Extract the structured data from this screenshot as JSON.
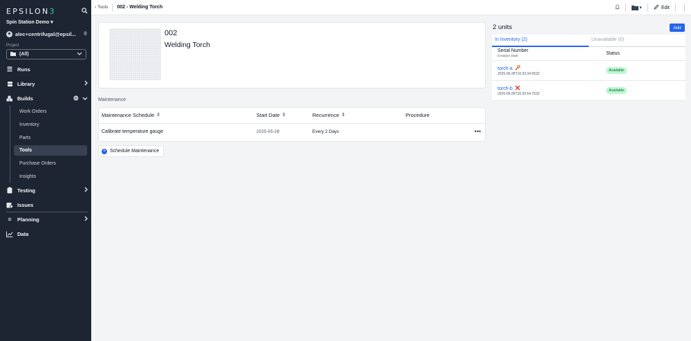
{
  "sidebar": {
    "logo_main": "EPSILON",
    "logo_accent": "3",
    "workspace": "Spin Station Demo",
    "user": "alec+centrifugal@epsil...",
    "project_label": "Project",
    "project_value": "(All)",
    "nav": {
      "runs": "Runs",
      "library": "Library",
      "builds": "Builds",
      "testing": "Testing",
      "issues": "Issues",
      "planning": "Planning",
      "data": "Data"
    },
    "builds_sub": [
      "Work Orders",
      "Inventory",
      "Parts",
      "Tools",
      "Purchase Orders",
      "Insights"
    ]
  },
  "topbar": {
    "back_label": "Tools",
    "title": "002 - Welding Torch",
    "edit_label": "Edit"
  },
  "tool": {
    "number": "002",
    "name": "Welding Torch"
  },
  "maintenance": {
    "section_label": "Maintenance",
    "columns": [
      "Maintenance Schedule",
      "Start Date",
      "Recurrence",
      "Procedure"
    ],
    "rows": [
      {
        "schedule": "Calibrate temperature gauge",
        "start_date": "2025-05-28",
        "recurrence": "Every 2 Days",
        "procedure": ""
      }
    ],
    "schedule_button": "Schedule Maintenance"
  },
  "units": {
    "title": "2 units",
    "add_label": "Add",
    "tab_in": "In Inventory (2)",
    "tab_out": "Unavailable (0)",
    "col_serial": "Serial Number",
    "col_serial_sub": "Creation Date",
    "col_status": "Status",
    "rows": [
      {
        "serial": "torch-a",
        "date": "2025-05-28T16:20:34.053Z",
        "status": "Available",
        "icon": "wrench-icon"
      },
      {
        "serial": "torch-b",
        "date": "2025-05-28T16:20:54.753Z",
        "status": "Available",
        "icon": "wrench-x-icon"
      }
    ]
  },
  "colors": {
    "sidebar_bg": "#1e2532",
    "accent_blue": "#2563eb",
    "logo_accent": "#22d3a4",
    "status_green_bg": "#bbf7d0"
  }
}
